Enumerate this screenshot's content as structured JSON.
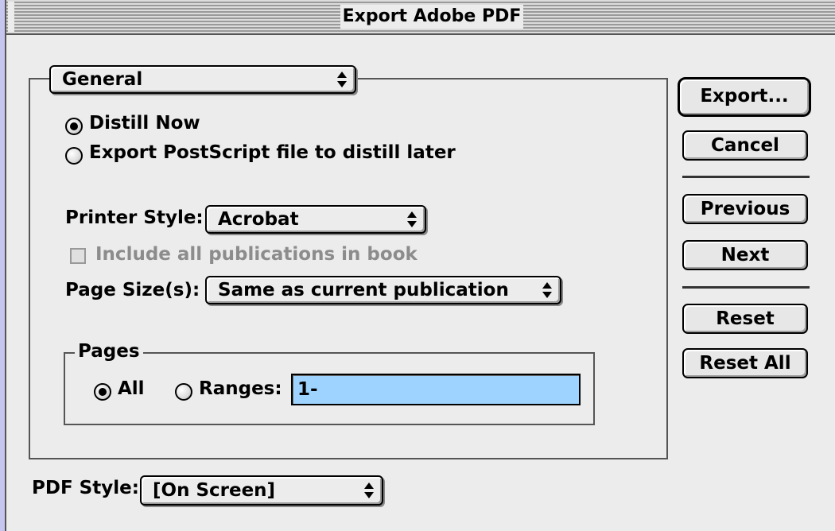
{
  "window": {
    "title": "Export Adobe PDF"
  },
  "panel": {
    "selected": "General"
  },
  "distill": {
    "option_now": "Distill Now",
    "option_later": "Export PostScript file to distill later",
    "selected": "Distill Now"
  },
  "printer_style": {
    "label": "Printer Style:",
    "value": "Acrobat"
  },
  "include_book": {
    "label": "Include all publications in book",
    "checked": false,
    "enabled": false
  },
  "page_sizes": {
    "label": "Page Size(s):",
    "value": "Same as current publication"
  },
  "pages": {
    "group_label": "Pages",
    "all_label": "All",
    "ranges_label": "Ranges:",
    "ranges_value": "1-",
    "selected": "All"
  },
  "buttons": {
    "export": "Export...",
    "cancel": "Cancel",
    "previous": "Previous",
    "next": "Next",
    "reset": "Reset",
    "reset_all": "Reset All"
  },
  "pdf_style": {
    "label": "PDF Style:",
    "value": "[On Screen]"
  },
  "colors": {
    "desktop": "#c6c6f0",
    "window": "#ececec",
    "field_highlight": "#9fd3ff"
  }
}
